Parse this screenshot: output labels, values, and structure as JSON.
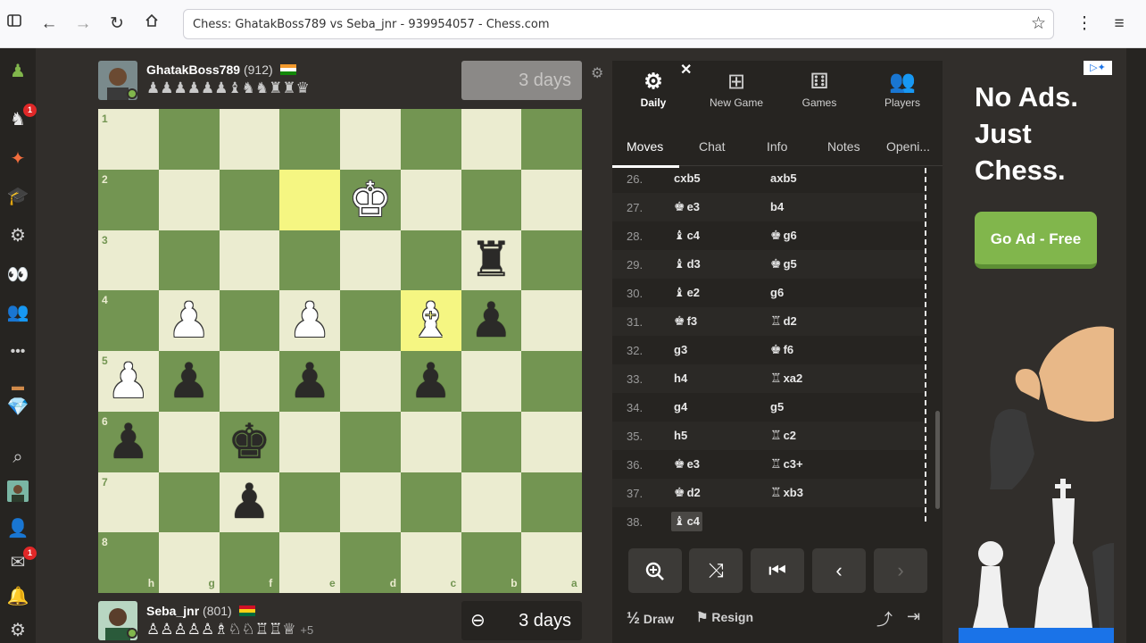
{
  "browser": {
    "url_title": "Chess: GhatakBoss789 vs Seba_jnr - 939954057 - Chess.com",
    "icons": [
      "sidebar-icon",
      "back-icon",
      "forward-icon",
      "reload-icon",
      "home-icon",
      "bookmark-star-icon",
      "kebab-menu-icon",
      "hamburger-menu-icon"
    ]
  },
  "nav": {
    "badges": {
      "learn": "1",
      "messages": "1"
    },
    "more_label": "•••"
  },
  "top_player": {
    "name": "GhatakBoss789",
    "rating": "(912)",
    "captured": "♟♟♟♟♟♟♝♞♞♜♜♛",
    "clock": "3 days"
  },
  "bottom_player": {
    "name": "Seba_jnr",
    "rating": "(801)",
    "captured": "♙♙♙♙♙♗♘♘♖♖♕",
    "captured_extra": "+5",
    "clock": "3 days"
  },
  "board": {
    "ranks": [
      "1",
      "2",
      "3",
      "4",
      "5",
      "6",
      "7",
      "8"
    ],
    "files": [
      "h",
      "g",
      "f",
      "e",
      "d",
      "c",
      "b",
      "a"
    ],
    "light": "#ebecd0",
    "dark": "#739552",
    "highlight_light": "#f5f682",
    "highlight_dark": "#b9ca43"
  },
  "panel": {
    "nav": [
      {
        "label": "Daily",
        "icon": "gear-icon"
      },
      {
        "label": "New Game",
        "icon": "plus-icon"
      },
      {
        "label": "Games",
        "icon": "dice-icon"
      },
      {
        "label": "Players",
        "icon": "people-icon"
      }
    ],
    "close": "✕",
    "tabs": [
      "Moves",
      "Chat",
      "Info",
      "Notes",
      "Openi..."
    ],
    "moves": [
      {
        "n": "26.",
        "wf": "",
        "w": "cxb5",
        "bf": "",
        "b": "axb5"
      },
      {
        "n": "27.",
        "wf": "♚",
        "w": "e3",
        "bf": "",
        "b": "b4"
      },
      {
        "n": "28.",
        "wf": "♝",
        "w": "c4",
        "bf": "♚",
        "b": "g6"
      },
      {
        "n": "29.",
        "wf": "♝",
        "w": "d3",
        "bf": "♚",
        "b": "g5"
      },
      {
        "n": "30.",
        "wf": "♝",
        "w": "e2",
        "bf": "",
        "b": "g6"
      },
      {
        "n": "31.",
        "wf": "♚",
        "w": "f3",
        "bf": "♖",
        "b": "d2"
      },
      {
        "n": "32.",
        "wf": "",
        "w": "g3",
        "bf": "♚",
        "b": "f6"
      },
      {
        "n": "33.",
        "wf": "",
        "w": "h4",
        "bf": "♖",
        "b": "xa2"
      },
      {
        "n": "34.",
        "wf": "",
        "w": "g4",
        "bf": "",
        "b": "g5"
      },
      {
        "n": "35.",
        "wf": "",
        "w": "h5",
        "bf": "♖",
        "b": "c2"
      },
      {
        "n": "36.",
        "wf": "♚",
        "w": "e3",
        "bf": "♖",
        "b": "c3+"
      },
      {
        "n": "37.",
        "wf": "♚",
        "w": "d2",
        "bf": "♖",
        "b": "xb3"
      },
      {
        "n": "38.",
        "wf": "♝",
        "w": "c4",
        "bf": "",
        "b": ""
      }
    ],
    "draw_label": "Draw",
    "draw_prefix": "½",
    "resign_label": "Resign"
  },
  "ad": {
    "title": "No Ads. Just Chess.",
    "button": "Go Ad - Free"
  }
}
